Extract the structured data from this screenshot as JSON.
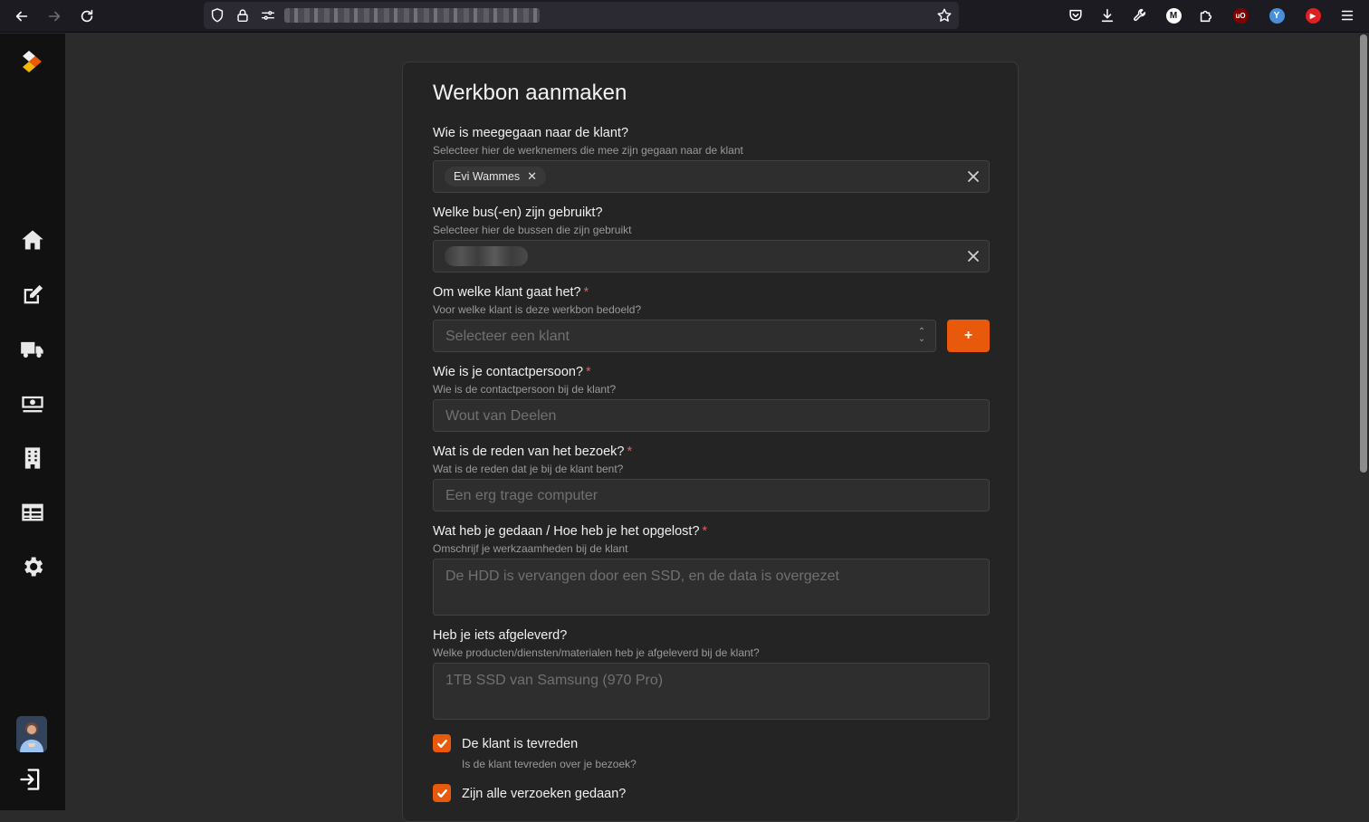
{
  "browser": {
    "url_redacted": true
  },
  "form": {
    "title": "Werkbon aanmaken",
    "employees": {
      "label": "Wie is meegegaan naar de klant?",
      "description": "Selecteer hier de werknemers die mee zijn gegaan naar de klant",
      "selected": [
        "Evi Wammes"
      ]
    },
    "buses": {
      "label": "Welke bus(-en) zijn gebruikt?",
      "description": "Selecteer hier de bussen die zijn gebruikt"
    },
    "customer": {
      "label": "Om welke klant gaat het?",
      "required_mark": "*",
      "description": "Voor welke klant is deze werkbon bedoeld?",
      "placeholder": "Selecteer een klant",
      "add_label": "+"
    },
    "contact": {
      "label": "Wie is je contactpersoon?",
      "required_mark": "*",
      "description": "Wie is de contactpersoon bij de klant?",
      "placeholder": "Wout van Deelen"
    },
    "reason": {
      "label": "Wat is de reden van het bezoek?",
      "required_mark": "*",
      "description": "Wat is de reden dat je bij de klant bent?",
      "placeholder": "Een erg trage computer"
    },
    "work_done": {
      "label": "Wat heb je gedaan / Hoe heb je het opgelost?",
      "required_mark": "*",
      "description": "Omschrijf je werkzaamheden bij de klant",
      "placeholder": "De HDD is vervangen door een SSD, en de data is overgezet"
    },
    "delivered": {
      "label": "Heb je iets afgeleverd?",
      "description": "Welke producten/diensten/materialen heb je afgeleverd bij de klant?",
      "placeholder": "1TB SSD van Samsung (970 Pro)"
    },
    "satisfied": {
      "label": "De klant is tevreden",
      "description": "Is de klant tevreden over je bezoek?",
      "checked": true
    },
    "all_requests": {
      "label": "Zijn alle verzoeken gedaan?",
      "checked": true
    }
  },
  "colors": {
    "accent": "#e8590c",
    "required": "#fa5252",
    "background": "#2b2b2b",
    "card": "#242424",
    "sidebar": "#111111"
  },
  "sidebar": {
    "icons": [
      "home-icon",
      "edit-icon",
      "truck-icon",
      "money-icon",
      "building-icon",
      "table-icon",
      "gear-icon"
    ]
  }
}
